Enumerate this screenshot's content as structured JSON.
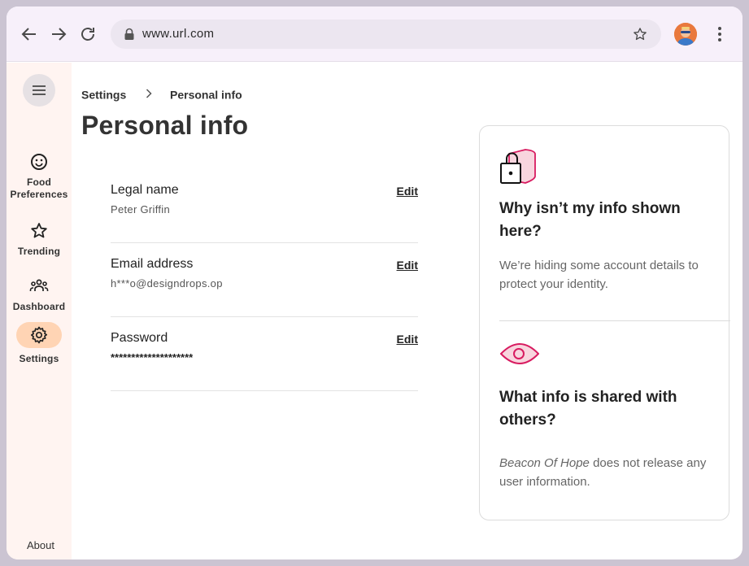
{
  "browser": {
    "url": "www.url.com",
    "back_icon": "arrow-left-icon",
    "forward_icon": "arrow-right-icon",
    "reload_icon": "reload-icon",
    "bookmark_icon": "star-outline-icon",
    "menu_icon": "vertical-dots-icon"
  },
  "sidebar": {
    "items": [
      {
        "label": "Food Preferences",
        "icon": "smiley-icon"
      },
      {
        "label": "Trending",
        "icon": "star-icon"
      },
      {
        "label": "Dashboard",
        "icon": "group-icon"
      },
      {
        "label": "Settings",
        "icon": "gear-icon",
        "active": true
      }
    ],
    "about": "About"
  },
  "breadcrumb": {
    "parent": "Settings",
    "current": "Personal info"
  },
  "page_title": "Personal info",
  "fields": [
    {
      "label": "Legal name",
      "value": "Peter Griffin",
      "action": "Edit"
    },
    {
      "label": "Email address",
      "value": "h***o@designdrops.op",
      "action": "Edit"
    },
    {
      "label": "Password",
      "value": "********************",
      "action": "Edit"
    }
  ],
  "info_card": {
    "section1": {
      "title": "Why isn’t my info shown here?",
      "body": "We’re hiding some account details to protect your identity."
    },
    "section2": {
      "title": "What info is shared with others?",
      "body_emphasis": "Beacon Of Hope",
      "body_rest": " does not release any user information."
    }
  },
  "colors": {
    "accent_pink": "#d81b60",
    "sidebar_bg": "#fff4f1",
    "active_pill": "#ffd4b4",
    "chrome_bg": "#f7f0fa"
  }
}
